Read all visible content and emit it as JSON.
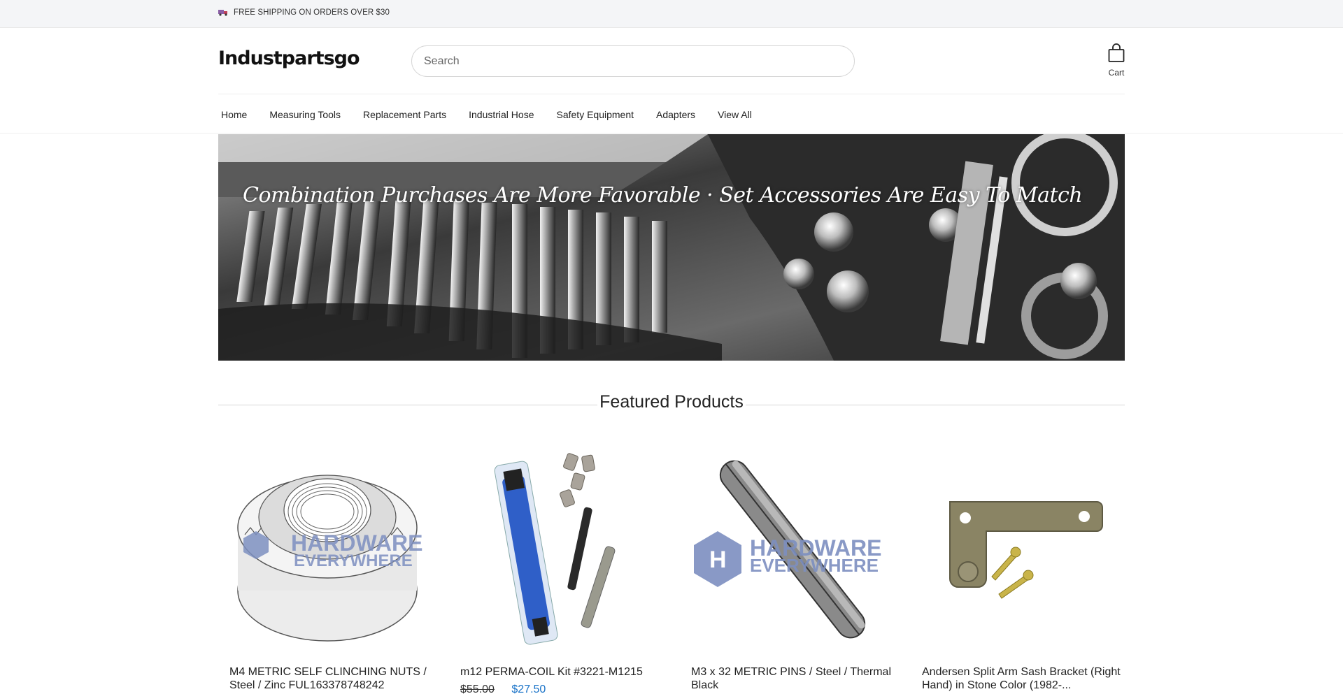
{
  "topbar": {
    "shipping_text": "FREE SHIPPING ON ORDERS OVER $30",
    "icon": "truck-icon"
  },
  "header": {
    "logo": "Industpartsgo",
    "search": {
      "placeholder": "Search",
      "value": ""
    },
    "cart_label": "Cart"
  },
  "nav": {
    "items": [
      {
        "label": "Home"
      },
      {
        "label": "Measuring Tools"
      },
      {
        "label": "Replacement Parts"
      },
      {
        "label": "Industrial Hose"
      },
      {
        "label": "Safety Equipment"
      },
      {
        "label": "Adapters"
      },
      {
        "label": "View All"
      }
    ]
  },
  "banner": {
    "title": "Combination Purchases Are More Favorable · Set Accessories Are Easy To Match"
  },
  "featured": {
    "title": "Featured Products",
    "products": [
      {
        "name": "M4 METRIC SELF CLINCHING NUTS / Steel / Zinc FUL163378748242",
        "image": "clinching-nut-image"
      },
      {
        "name": "m12 PERMA-COIL Kit #3221-M1215",
        "image": "perma-coil-kit-image",
        "price_old": "$55.00",
        "price_new": "$27.50"
      },
      {
        "name": "M3 x 32 METRIC PINS / Steel / Thermal Black",
        "image": "metric-pin-image"
      },
      {
        "name": "Andersen Split Arm Sash Bracket (Right Hand) in Stone Color (1982-...",
        "image": "sash-bracket-image"
      }
    ]
  },
  "colors": {
    "accent": "#1a73c8",
    "topbar_bg": "#f4f5f7",
    "watermark": "#7d8fc0"
  }
}
